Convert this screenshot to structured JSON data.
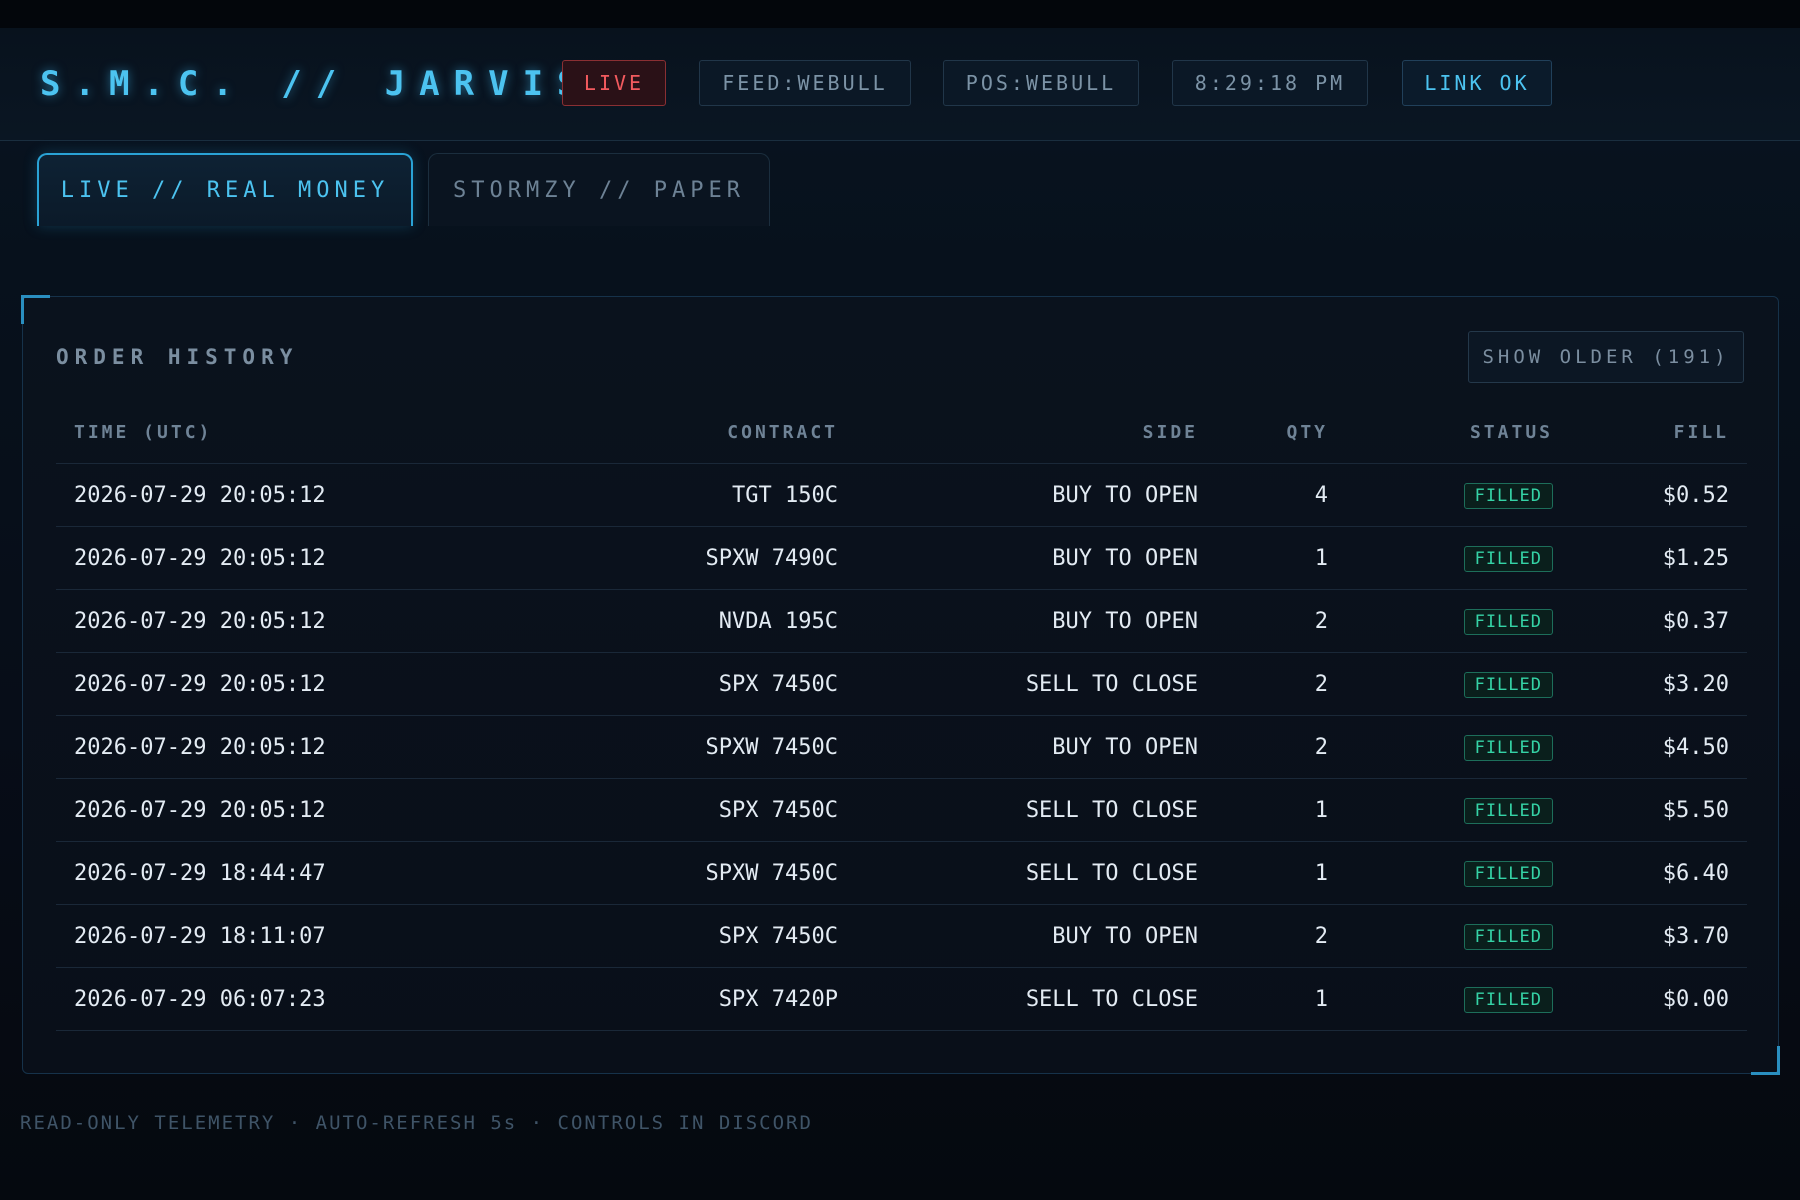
{
  "header": {
    "brand": "S.M.C. // JARVIS",
    "live_badge": "LIVE",
    "feed": "FEED:WEBULL",
    "pos": "POS:WEBULL",
    "clock": "8:29:18 PM",
    "link": "LINK OK"
  },
  "tabs": [
    {
      "label": "LIVE // REAL MONEY",
      "active": true
    },
    {
      "label": "STORMZY // PAPER",
      "active": false
    }
  ],
  "order_history": {
    "title": "ORDER HISTORY",
    "show_older_label": "SHOW OLDER (191)",
    "columns": [
      "TIME (UTC)",
      "CONTRACT",
      "SIDE",
      "QTY",
      "STATUS",
      "FILL"
    ],
    "rows": [
      {
        "time": "2026-07-29 20:05:12",
        "contract": "TGT 150C",
        "side": "BUY TO OPEN",
        "qty": "4",
        "status": "FILLED",
        "fill": "$0.52"
      },
      {
        "time": "2026-07-29 20:05:12",
        "contract": "SPXW 7490C",
        "side": "BUY TO OPEN",
        "qty": "1",
        "status": "FILLED",
        "fill": "$1.25"
      },
      {
        "time": "2026-07-29 20:05:12",
        "contract": "NVDA 195C",
        "side": "BUY TO OPEN",
        "qty": "2",
        "status": "FILLED",
        "fill": "$0.37"
      },
      {
        "time": "2026-07-29 20:05:12",
        "contract": "SPX 7450C",
        "side": "SELL TO CLOSE",
        "qty": "2",
        "status": "FILLED",
        "fill": "$3.20"
      },
      {
        "time": "2026-07-29 20:05:12",
        "contract": "SPXW 7450C",
        "side": "BUY TO OPEN",
        "qty": "2",
        "status": "FILLED",
        "fill": "$4.50"
      },
      {
        "time": "2026-07-29 20:05:12",
        "contract": "SPX 7450C",
        "side": "SELL TO CLOSE",
        "qty": "1",
        "status": "FILLED",
        "fill": "$5.50"
      },
      {
        "time": "2026-07-29 18:44:47",
        "contract": "SPXW 7450C",
        "side": "SELL TO CLOSE",
        "qty": "1",
        "status": "FILLED",
        "fill": "$6.40"
      },
      {
        "time": "2026-07-29 18:11:07",
        "contract": "SPX 7450C",
        "side": "BUY TO OPEN",
        "qty": "2",
        "status": "FILLED",
        "fill": "$3.70"
      },
      {
        "time": "2026-07-29 06:07:23",
        "contract": "SPX 7420P",
        "side": "SELL TO CLOSE",
        "qty": "1",
        "status": "FILLED",
        "fill": "$0.00"
      }
    ]
  },
  "footer": "READ-ONLY TELEMETRY · AUTO-REFRESH 5s · CONTROLS IN DISCORD",
  "colors": {
    "accent": "#4cc3f0",
    "live": "#f25a5e",
    "status_filled": "#35d3a6",
    "background": "#070d18"
  }
}
